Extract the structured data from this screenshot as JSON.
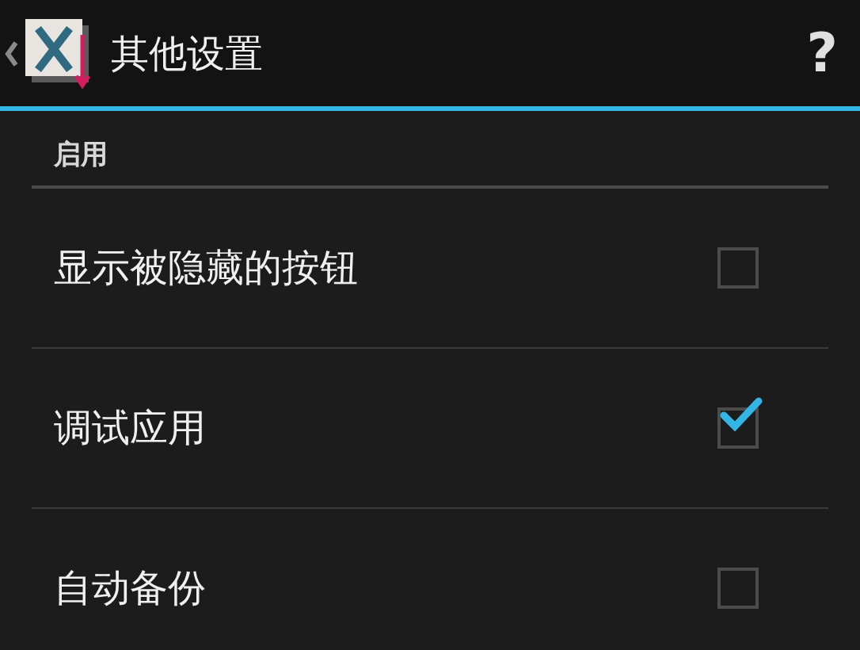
{
  "action_bar": {
    "title": "其他设置",
    "help": "?"
  },
  "category": {
    "title": "启用"
  },
  "settings": [
    {
      "label": "显示被隐藏的按钮",
      "checked": false
    },
    {
      "label": "调试应用",
      "checked": true
    },
    {
      "label": "自动备份",
      "checked": false
    }
  ]
}
